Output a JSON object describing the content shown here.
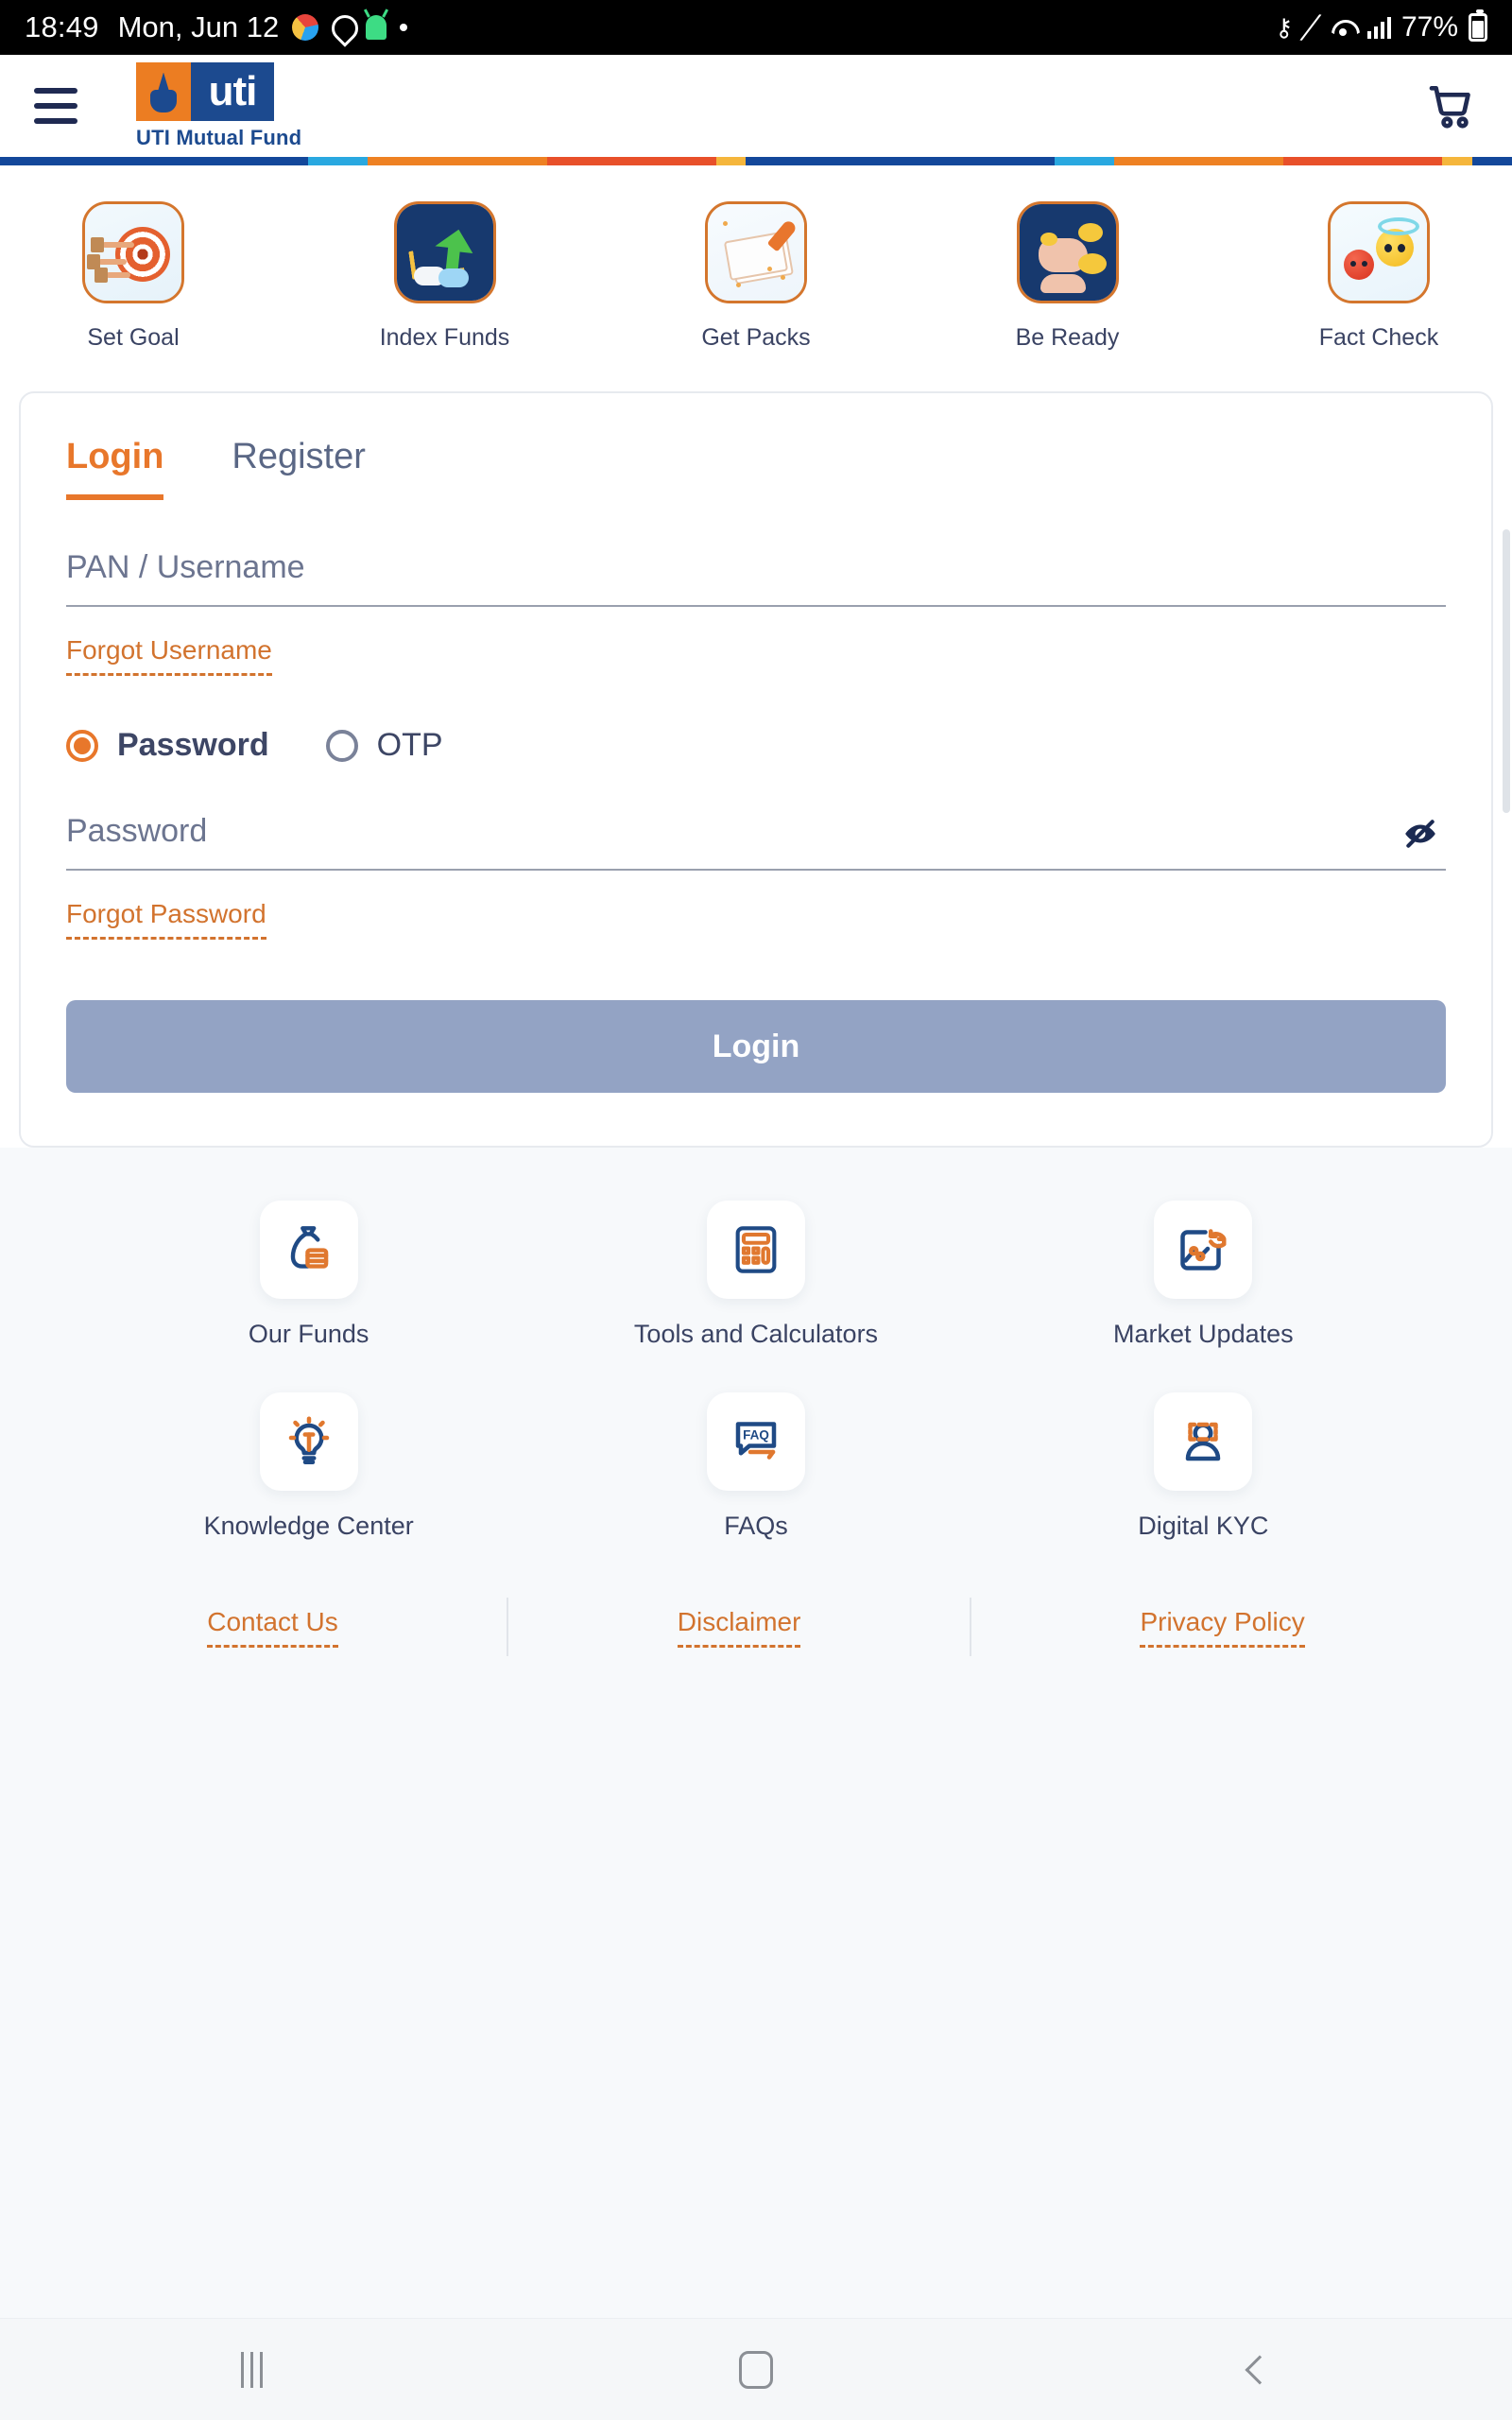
{
  "status_bar": {
    "time": "18:49",
    "date": "Mon, Jun 12",
    "battery": "77%",
    "icons_left": [
      "chrome-icon",
      "location-pin-icon",
      "android-icon",
      "dot-icon"
    ],
    "icons_right": [
      "vpn-key-icon",
      "pen-icon",
      "wifi-icon",
      "signal-icon",
      "battery-icon"
    ]
  },
  "app_bar": {
    "menu_icon": "hamburger-menu-icon",
    "logo_mark": "uti",
    "logo_text": "UTI Mutual Fund",
    "cart_icon": "shopping-cart-icon"
  },
  "brand_stripe": {
    "colors": [
      "#13479a",
      "#29a8e0",
      "#ee8123",
      "#e8502a",
      "#f5b63c",
      "#13479a",
      "#29a8e0",
      "#ee8123",
      "#e8502a",
      "#f5b63c",
      "#13479a"
    ]
  },
  "quick_links": [
    {
      "label": "Set Goal",
      "icon": "target-dart-icon"
    },
    {
      "label": "Index Funds",
      "icon": "growth-arrow-icon"
    },
    {
      "label": "Get Packs",
      "icon": "documents-rocket-icon"
    },
    {
      "label": "Be Ready",
      "icon": "piggy-bank-icon"
    },
    {
      "label": "Fact Check",
      "icon": "devil-angel-emoji-icon"
    }
  ],
  "login_card": {
    "tabs": [
      {
        "label": "Login",
        "active": true
      },
      {
        "label": "Register",
        "active": false
      }
    ],
    "username": {
      "placeholder": "PAN / Username",
      "value": ""
    },
    "forgot_username": "Forgot Username",
    "auth_methods": [
      {
        "label": "Password",
        "selected": true
      },
      {
        "label": "OTP",
        "selected": false
      }
    ],
    "password": {
      "placeholder": "Password",
      "value": "",
      "toggle_icon": "eye-slash-icon"
    },
    "forgot_password": "Forgot Password",
    "submit_label": "Login",
    "submit_disabled": true
  },
  "services": [
    {
      "label": "Our Funds",
      "icon": "money-bag-icon"
    },
    {
      "label": "Tools and Calculators",
      "icon": "calculator-icon"
    },
    {
      "label": "Market Updates",
      "icon": "chart-refresh-icon"
    },
    {
      "label": "Knowledge Center",
      "icon": "lightbulb-icon"
    },
    {
      "label": "FAQs",
      "icon": "faq-speech-bubble-icon"
    },
    {
      "label": "Digital KYC",
      "icon": "person-scan-icon"
    }
  ],
  "footer_links": [
    {
      "label": "Contact Us"
    },
    {
      "label": "Disclaimer"
    },
    {
      "label": "Privacy Policy"
    }
  ],
  "nav_bar": {
    "recents": "recents-icon",
    "home": "home-icon",
    "back": "back-icon"
  },
  "colors": {
    "accent_orange": "#e8772b",
    "link_orange": "#d2732e",
    "brand_blue": "#1c4a8f",
    "text_navy": "#3a4363",
    "disabled_button": "#93a3c4"
  }
}
